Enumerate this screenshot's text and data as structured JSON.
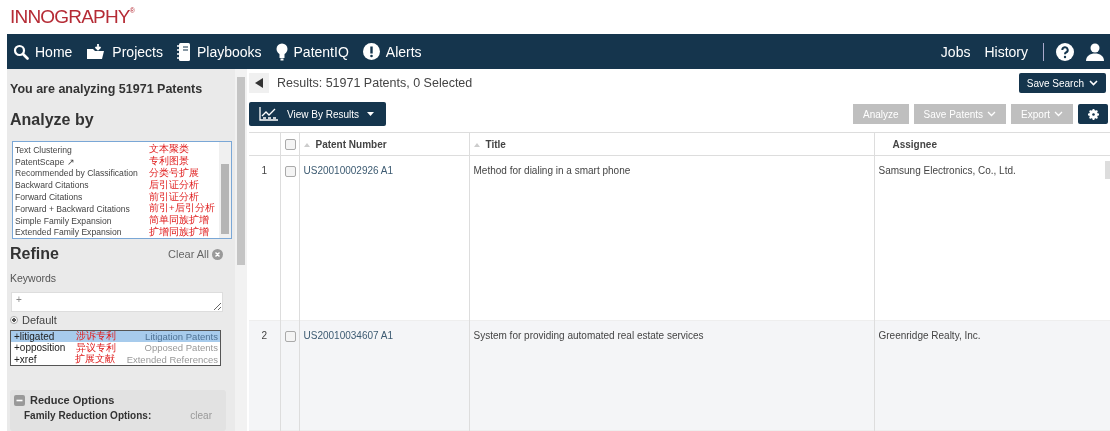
{
  "logo": "INNOGRAPHY",
  "logo_mark": "®",
  "nav": {
    "left": [
      {
        "label": "Home"
      },
      {
        "label": "Projects"
      },
      {
        "label": "Playbooks"
      },
      {
        "label": "PatentIQ"
      },
      {
        "label": "Alerts"
      }
    ],
    "right": [
      {
        "label": "Jobs"
      },
      {
        "label": "History"
      }
    ]
  },
  "sidebar": {
    "analyzing": "You are analyzing 51971 Patents",
    "analyze_heading": "Analyze by",
    "analyze_options": [
      {
        "label": "Text Clustering",
        "note": "文本聚类"
      },
      {
        "label": "PatentScape ↗",
        "note": "专利图景"
      },
      {
        "label": "Recommended by Classification",
        "note": "分类号扩展"
      },
      {
        "label": "Backward Citations",
        "note": "后引证分析"
      },
      {
        "label": "Forward Citations",
        "note": "前引证分析"
      },
      {
        "label": "Forward + Backward Citations",
        "note": "前引+后引分析"
      },
      {
        "label": "Simple Family Expansion",
        "note": "简单同族扩增"
      },
      {
        "label": "Extended Family Expansion",
        "note": "扩增同族扩增"
      }
    ],
    "refine_heading": "Refine",
    "clear_all": "Clear All",
    "keywords_label": "Keywords",
    "keywords_value": "+",
    "radio": {
      "label": "Default",
      "selected": true
    },
    "suggestions": [
      {
        "keyword": "+litigated",
        "note": "涉诉专利",
        "hint": "Litigation Patents",
        "selected": true
      },
      {
        "keyword": "+opposition",
        "note": "异议专利",
        "hint": "Opposed Patents",
        "selected": false
      },
      {
        "keyword": "+xref",
        "note": "扩展文献",
        "hint": "Extended References",
        "selected": false
      }
    ],
    "reduce_heading": "Reduce Options",
    "family_reduction": "Family Reduction Options:",
    "clear": "clear"
  },
  "results": {
    "summary": "Results: 51971 Patents, 0 Selected",
    "save_search": "Save Search",
    "view_by": "View By Results",
    "actions": [
      {
        "label": "Analyze",
        "disabled": true,
        "dropdown": false
      },
      {
        "label": "Save Patents",
        "disabled": true,
        "dropdown": true
      },
      {
        "label": "Export",
        "disabled": true,
        "dropdown": true
      }
    ],
    "columns": [
      "Patent Number",
      "Title",
      "Assignee"
    ],
    "select_all_checked": false,
    "rows": [
      {
        "index": "1",
        "checked": false,
        "patent_number": "US20010002926 A1",
        "title": "Method for dialing in a smart phone",
        "assignee": "Samsung Electronics, Co., Ltd."
      },
      {
        "index": "2",
        "checked": false,
        "patent_number": "US20010034607 A1",
        "title": "System for providing automated real estate services",
        "assignee": "Greenridge Realty, Inc."
      }
    ]
  }
}
